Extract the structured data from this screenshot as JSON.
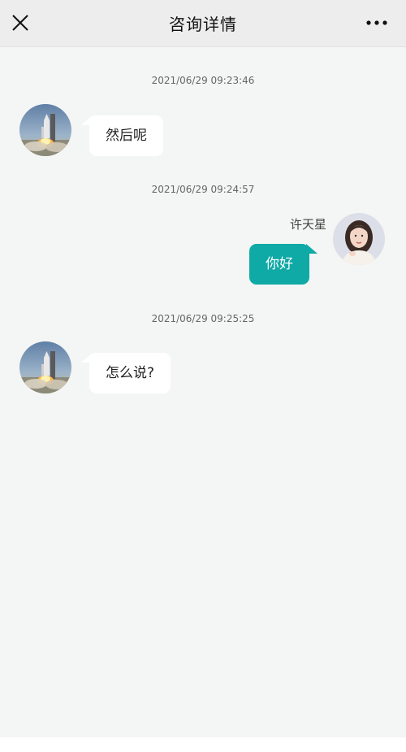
{
  "header": {
    "title": "咨询详情",
    "close_icon": "close-icon",
    "more_icon": "more-dots-icon"
  },
  "messages": [
    {
      "timestamp": "2021/06/29 09:23:46",
      "side": "left",
      "avatar": "rocket-launch-avatar",
      "text": "然后呢"
    },
    {
      "timestamp": "2021/06/29 09:24:57",
      "side": "right",
      "sender": "许天星",
      "avatar": "woman-portrait-avatar",
      "text": "你好"
    },
    {
      "timestamp": "2021/06/29 09:25:25",
      "side": "left",
      "avatar": "rocket-launch-avatar",
      "text": "怎么说?"
    }
  ],
  "colors": {
    "header_bg": "#ededed",
    "chat_bg": "#f4f5f5",
    "my_bubble": "#0fa9a6",
    "their_bubble": "#ffffff"
  }
}
